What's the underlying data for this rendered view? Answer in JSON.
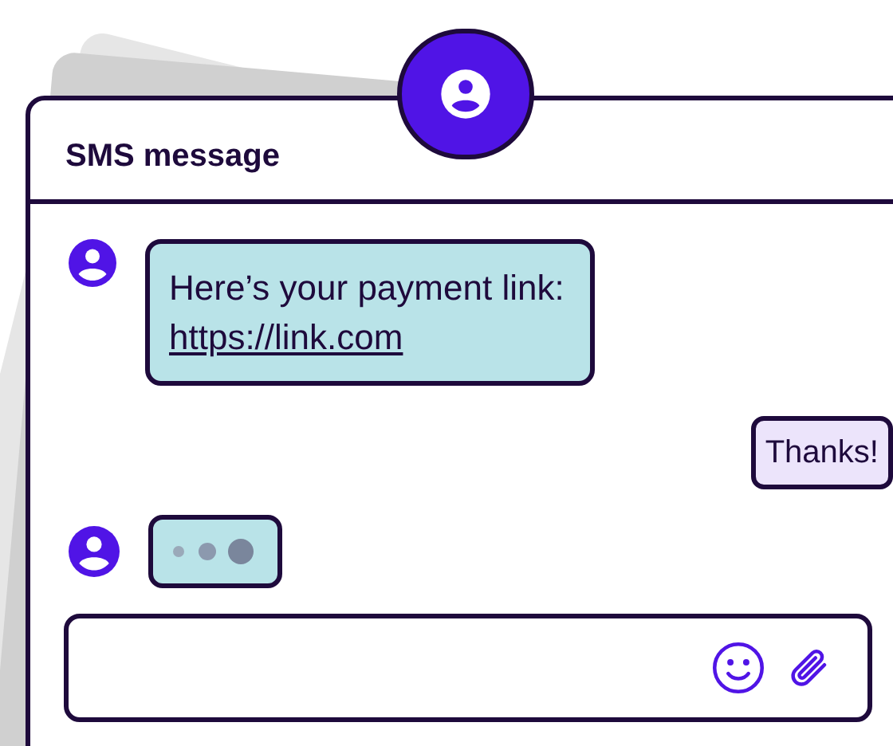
{
  "header": {
    "title": "SMS message"
  },
  "messages": [
    {
      "kind": "incoming",
      "text": "Here’s your payment link: ",
      "link": "https://link.com"
    },
    {
      "kind": "outgoing",
      "text": "Thanks!"
    },
    {
      "kind": "typing"
    }
  ]
}
